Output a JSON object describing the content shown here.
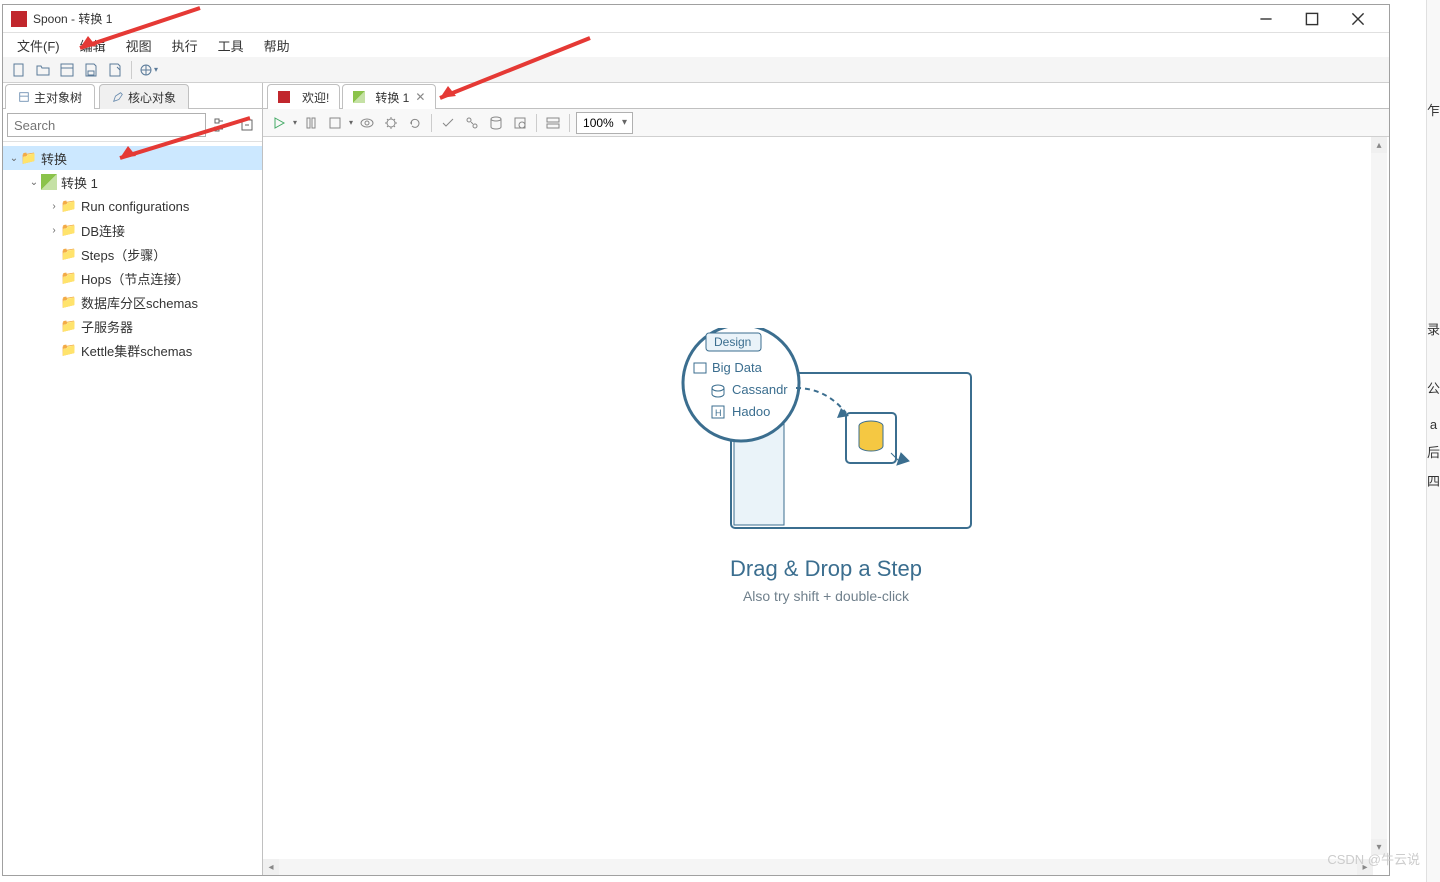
{
  "title": "Spoon - 转换 1",
  "menu": [
    "文件(F)",
    "编辑",
    "视图",
    "执行",
    "工具",
    "帮助"
  ],
  "left_tabs": [
    "主对象树",
    "核心对象"
  ],
  "search": {
    "placeholder": "Search"
  },
  "tree": {
    "root": "转换",
    "child": "转换 1",
    "items": [
      "Run configurations",
      "DB连接",
      "Steps（步骤）",
      "Hops（节点连接）",
      "数据库分区schemas",
      "子服务器",
      "Kettle集群schemas"
    ]
  },
  "right_tabs": [
    {
      "label": "欢迎!",
      "icon": "app",
      "closable": false
    },
    {
      "label": "转换 1",
      "icon": "trans",
      "closable": true
    }
  ],
  "zoom": "100%",
  "canvas": {
    "design_tab": "Design",
    "item1": "Big Data",
    "item2": "Cassandr",
    "item3": "Hadoo",
    "title": "Drag & Drop a Step",
    "subtitle": "Also try shift + double-click"
  },
  "watermark": "CSDN @牛云说"
}
